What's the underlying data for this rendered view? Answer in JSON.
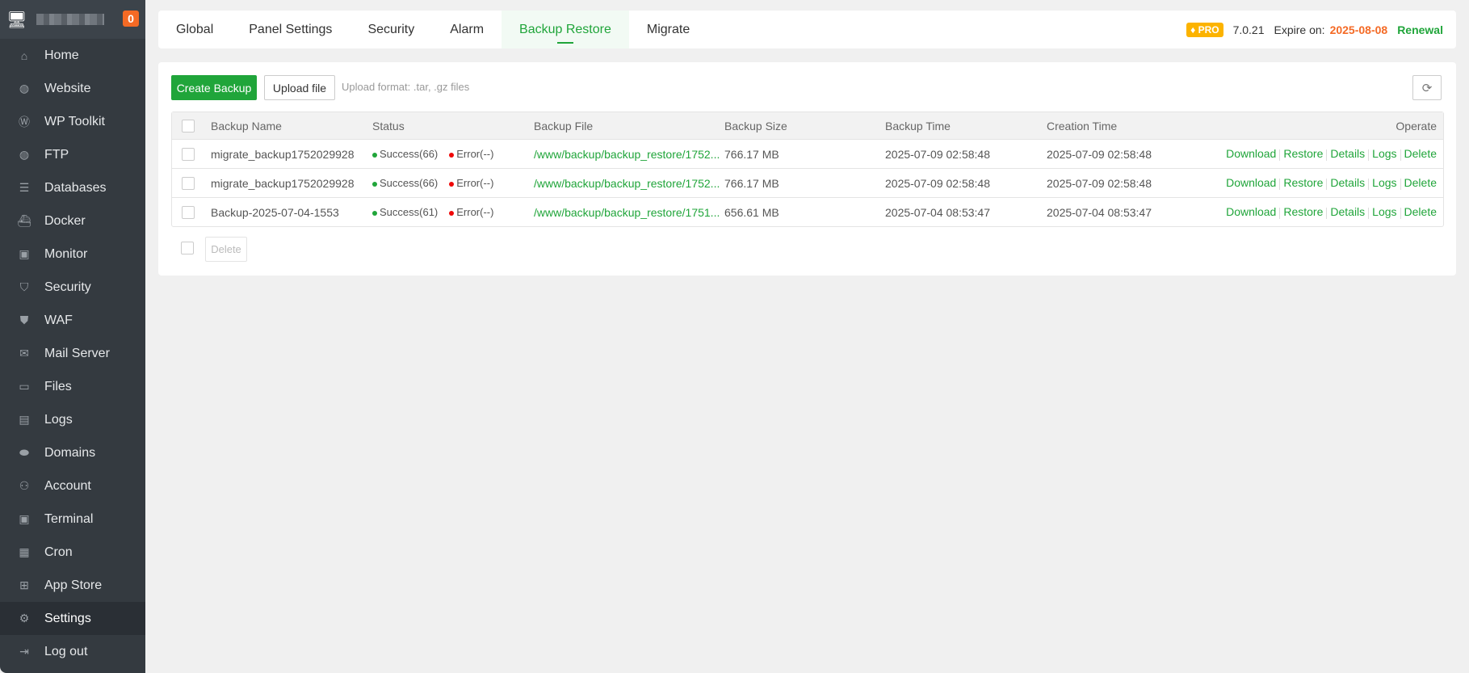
{
  "sidebar": {
    "server_badge": "0",
    "items": [
      {
        "label": "Home",
        "icon": "home-icon"
      },
      {
        "label": "Website",
        "icon": "globe-icon"
      },
      {
        "label": "WP Toolkit",
        "icon": "wordpress-icon"
      },
      {
        "label": "FTP",
        "icon": "ftp-icon"
      },
      {
        "label": "Databases",
        "icon": "database-icon"
      },
      {
        "label": "Docker",
        "icon": "docker-icon"
      },
      {
        "label": "Monitor",
        "icon": "monitor-icon"
      },
      {
        "label": "Security",
        "icon": "shield-icon"
      },
      {
        "label": "WAF",
        "icon": "waf-icon"
      },
      {
        "label": "Mail Server",
        "icon": "mail-icon"
      },
      {
        "label": "Files",
        "icon": "folder-icon"
      },
      {
        "label": "Logs",
        "icon": "logs-icon"
      },
      {
        "label": "Domains",
        "icon": "www-icon"
      },
      {
        "label": "Account",
        "icon": "users-icon"
      },
      {
        "label": "Terminal",
        "icon": "terminal-icon"
      },
      {
        "label": "Cron",
        "icon": "calendar-icon"
      },
      {
        "label": "App Store",
        "icon": "grid-icon"
      },
      {
        "label": "Settings",
        "icon": "gear-icon"
      },
      {
        "label": "Log out",
        "icon": "logout-icon"
      }
    ]
  },
  "tabs": [
    "Global",
    "Panel Settings",
    "Security",
    "Alarm",
    "Backup Restore",
    "Migrate"
  ],
  "header": {
    "pro": "PRO",
    "version": "7.0.21",
    "expire_label": "Expire on:",
    "expire_date": "2025-08-08",
    "renewal": "Renewal"
  },
  "toolbar": {
    "create": "Create Backup",
    "upload": "Upload file",
    "hint": "Upload format: .tar, .gz files"
  },
  "table": {
    "headers": [
      "Backup Name",
      "Status",
      "Backup File",
      "Backup Size",
      "Backup Time",
      "Creation Time",
      "Operate"
    ],
    "rows": [
      {
        "name": "migrate_backup1752029928",
        "success": "Success(66)",
        "error": "Error(--)",
        "file": "/www/backup/backup_restore/1752...",
        "size": "766.17 MB",
        "backup_time": "2025-07-09 02:58:48",
        "creation_time": "2025-07-09 02:58:48"
      },
      {
        "name": "migrate_backup1752029928",
        "success": "Success(66)",
        "error": "Error(--)",
        "file": "/www/backup/backup_restore/1752...",
        "size": "766.17 MB",
        "backup_time": "2025-07-09 02:58:48",
        "creation_time": "2025-07-09 02:58:48"
      },
      {
        "name": "Backup-2025-07-04-1553",
        "success": "Success(61)",
        "error": "Error(--)",
        "file": "/www/backup/backup_restore/1751...",
        "size": "656.61 MB",
        "backup_time": "2025-07-04 08:53:47",
        "creation_time": "2025-07-04 08:53:47"
      }
    ],
    "ops": [
      "Download",
      "Restore",
      "Details",
      "Logs",
      "Delete"
    ]
  },
  "footer": {
    "delete": "Delete"
  }
}
